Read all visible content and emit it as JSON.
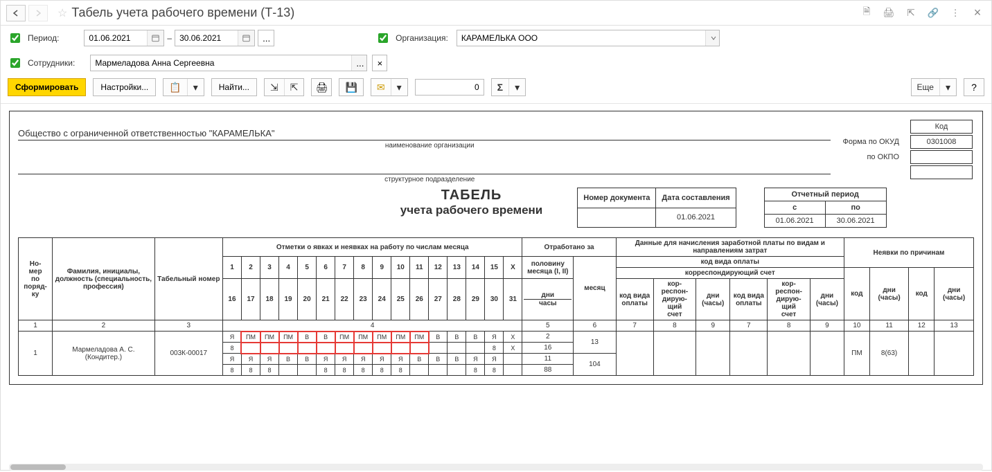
{
  "title": "Табель учета рабочего времени (Т-13)",
  "filters": {
    "period_label": "Период:",
    "date_from": "01.06.2021",
    "date_to": "30.06.2021",
    "dash": "–",
    "org_label": "Организация:",
    "org_value": "КАРАМЕЛЬКА ООО",
    "emp_label": "Сотрудники:",
    "emp_value": "Мармеладова Анна Сергеевна",
    "more": "..."
  },
  "toolbar": {
    "form": "Сформировать",
    "settings": "Настройки...",
    "find": "Найти...",
    "page_num": "0",
    "more": "Еще",
    "help": "?",
    "sigma": "Σ"
  },
  "report": {
    "org_full": "Общество с ограниченной ответственностью \"КАРАМЕЛЬКА\"",
    "org_sub": "наименование организации",
    "dept_sub": "структурное подразделение",
    "codes": {
      "header": "Код",
      "okud_label": "Форма по ОКУД",
      "okud": "0301008",
      "okpo_label": "по ОКПО",
      "okpo": ""
    },
    "title": "ТАБЕЛЬ",
    "subtitle": "учета  рабочего времени",
    "doc_table": {
      "h1": "Номер документа",
      "h2": "Дата составления",
      "v1": "",
      "v2": "01.06.2021"
    },
    "period_table": {
      "h": "Отчетный период",
      "h1": "с",
      "h2": "по",
      "v1": "01.06.2021",
      "v2": "30.06.2021"
    },
    "grid": {
      "h_num": "Но-\nмер\nпо\nпоряд-\nку",
      "h_fio": "Фамилия, инициалы, должность (специальность, профессия)",
      "h_tab": "Табельный номер",
      "h_marks": "Отметки о явках и неявках на работу по числам месяца",
      "h_worked": "Отработано за",
      "h_worked_half": "половину месяца (I, II)",
      "h_worked_month": "месяц",
      "h_worked_days": "дни",
      "h_worked_hours": "часы",
      "h_pay": "Данные для начисления заработной платы по видам и направлениям затрат",
      "h_pay_code_type": "код вида оплаты",
      "h_pay_account": "корреспондирующий счет",
      "h_pay_code": "код вида оплаты",
      "h_pay_corr": "кор-\nреспон-\nдирую-\nщий\nсчет",
      "h_pay_dh": "дни\n(часы)",
      "h_absence": "Неявки по причинам",
      "h_abs_code": "код",
      "h_abs_dh": "дни\n(часы)",
      "days1": [
        "1",
        "2",
        "3",
        "4",
        "5",
        "6",
        "7",
        "8",
        "9",
        "10",
        "11",
        "12",
        "13",
        "14",
        "15",
        "X"
      ],
      "days2": [
        "16",
        "17",
        "18",
        "19",
        "20",
        "21",
        "22",
        "23",
        "24",
        "25",
        "26",
        "27",
        "28",
        "29",
        "30",
        "31"
      ],
      "colnums": [
        "1",
        "2",
        "3",
        "4",
        "5",
        "6",
        "7",
        "8",
        "9",
        "10",
        "11",
        "12",
        "13"
      ],
      "row": {
        "num": "1",
        "fio": "Мармеладова А. С.\n(Кондитер.)",
        "tab": "003К-00017",
        "r1": [
          "Я",
          "ПМ",
          "ПМ",
          "ПМ",
          "В",
          "В",
          "ПМ",
          "ПМ",
          "ПМ",
          "ПМ",
          "ПМ",
          "В",
          "В",
          "В",
          "Я",
          "X"
        ],
        "r2": [
          "8",
          "",
          "",
          "",
          "",
          "",
          "",
          "",
          "",
          "",
          "",
          "",
          "",
          "",
          "8",
          "X"
        ],
        "r3": [
          "Я",
          "Я",
          "Я",
          "В",
          "В",
          "Я",
          "Я",
          "Я",
          "Я",
          "Я",
          "В",
          "В",
          "В",
          "Я",
          "Я",
          ""
        ],
        "r4": [
          "8",
          "8",
          "8",
          "",
          "",
          "8",
          "8",
          "8",
          "8",
          "8",
          "",
          "",
          "",
          "8",
          "8",
          ""
        ],
        "hl1": [
          false,
          true,
          true,
          true,
          true,
          true,
          true,
          true,
          true,
          true,
          true,
          false,
          false,
          false,
          false,
          false
        ],
        "half_days_1": "2",
        "half_hours_1": "16",
        "half_days_2": "11",
        "half_hours_2": "88",
        "month_days": "13",
        "month_hours": "104",
        "abs_code": "ПМ",
        "abs_dh": "8(63)"
      }
    }
  }
}
